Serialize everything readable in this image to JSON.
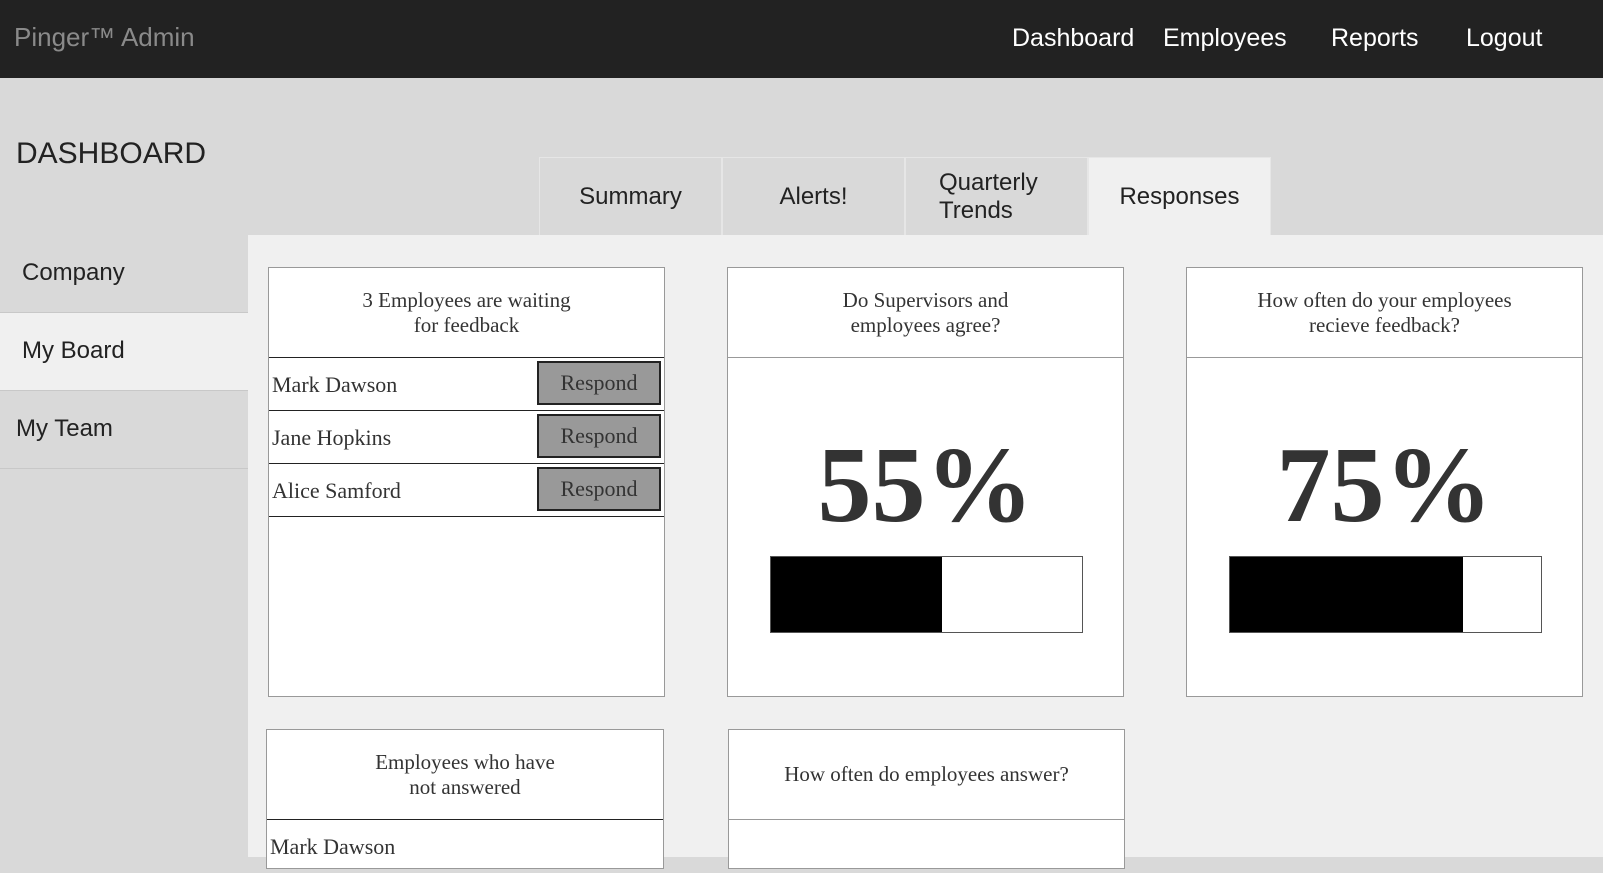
{
  "header": {
    "brand": "Pinger™ Admin",
    "nav": [
      "Dashboard",
      "Employees",
      "Reports",
      "Logout"
    ]
  },
  "page_title": "DASHBOARD",
  "tabs": [
    "Summary",
    "Alerts!",
    "Quarterly\nTrends",
    "Responses"
  ],
  "active_tab": "Responses",
  "sidebar": {
    "items": [
      "Company",
      "My Board",
      "My Team"
    ],
    "active": "My Board"
  },
  "cards": {
    "waiting": {
      "title": "3 Employees are waiting\nfor feedback",
      "rows": [
        {
          "name": "Mark Dawson",
          "action": "Respond"
        },
        {
          "name": "Jane Hopkins",
          "action": "Respond"
        },
        {
          "name": "Alice Samford",
          "action": "Respond"
        }
      ]
    },
    "agree": {
      "title": "Do Supervisors and\nemployees agree?",
      "value_label": "55%",
      "value": 0.55
    },
    "feedback_freq": {
      "title": "How often do your employees\nrecieve feedback?",
      "value_label": "75%",
      "value": 0.75
    },
    "not_answered": {
      "title": "Employees who have\nnot answered",
      "rows": [
        {
          "name": "Mark Dawson"
        }
      ]
    },
    "answer_freq": {
      "title": "How often do employees answer?"
    }
  }
}
